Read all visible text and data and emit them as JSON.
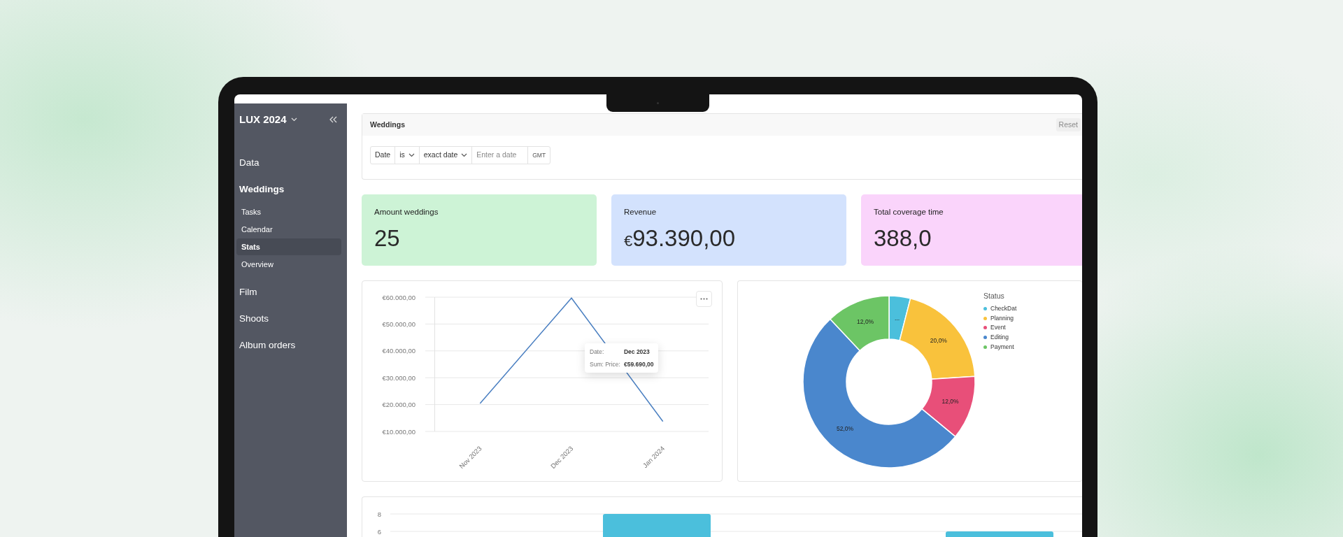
{
  "sidebar": {
    "workspace": "LUX 2024",
    "items": [
      {
        "label": "Data",
        "selected": false,
        "expanded": false
      },
      {
        "label": "Weddings",
        "selected": false,
        "expanded": true,
        "children": [
          {
            "label": "Tasks",
            "selected": false
          },
          {
            "label": "Calendar",
            "selected": false
          },
          {
            "label": "Stats",
            "selected": true
          },
          {
            "label": "Overview",
            "selected": false
          }
        ]
      },
      {
        "label": "Film",
        "selected": false,
        "expanded": false
      },
      {
        "label": "Shoots",
        "selected": false,
        "expanded": false
      },
      {
        "label": "Album orders",
        "selected": false,
        "expanded": false
      }
    ]
  },
  "filter_panel": {
    "title": "Weddings",
    "reset_button": "Reset",
    "filter": {
      "field": "Date",
      "operator": "is",
      "mode": "exact date",
      "placeholder": "Enter a date",
      "timezone": "GMT"
    }
  },
  "stat_cards": [
    {
      "label": "Amount weddings",
      "value": "25",
      "color": "#cdf3d6"
    },
    {
      "label": "Revenue",
      "currency": "€",
      "value": "93.390,00",
      "color": "#d3e2fd"
    },
    {
      "label": "Total coverage time",
      "value": "388,0",
      "color": "#fad4fb"
    }
  ],
  "line_chart": {
    "chart_data": {
      "type": "line",
      "categories": [
        "Nov 2023",
        "Dec 2023",
        "Jan 2024"
      ],
      "series": [
        {
          "color": "#4a7fc1",
          "values": [
            20400,
            59690,
            13700
          ]
        }
      ],
      "ylim": [
        10000,
        60000
      ],
      "grid": true,
      "yticks": [
        {
          "value": 10000,
          "label": "€10.000,00"
        },
        {
          "value": 20000,
          "label": "€20.000,00"
        },
        {
          "value": 30000,
          "label": "€30.000,00"
        },
        {
          "value": 40000,
          "label": "€40.000,00"
        },
        {
          "value": 50000,
          "label": "€50.000,00"
        },
        {
          "value": 60000,
          "label": "€60.000,00"
        }
      ]
    },
    "tooltip": [
      {
        "label": "Date:",
        "value": "Dec 2023"
      },
      {
        "label": "Sum: Price:",
        "value": "€59.690,00"
      }
    ]
  },
  "donut_chart": {
    "legend_title": "Status",
    "chart_data": {
      "type": "donut",
      "categories": [
        "CheckDat",
        "Planning",
        "Event",
        "Editing",
        "Payment"
      ],
      "values": [
        4,
        20,
        12,
        52,
        12
      ],
      "colors": [
        "#4bbfdc",
        "#f9c23c",
        "#e84f79",
        "#4a87cd",
        "#6cc565"
      ],
      "value_labels": [
        "...",
        "20,0%",
        "12,0%",
        "52,0%",
        "12,0%"
      ]
    }
  },
  "bar_chart": {
    "chart_data": {
      "type": "bar",
      "ylim": [
        0,
        8
      ],
      "yticks": [
        6,
        8
      ],
      "grid": true,
      "series": [
        {
          "color": "#4bbfdc",
          "values": [
            8,
            6
          ]
        }
      ]
    }
  }
}
